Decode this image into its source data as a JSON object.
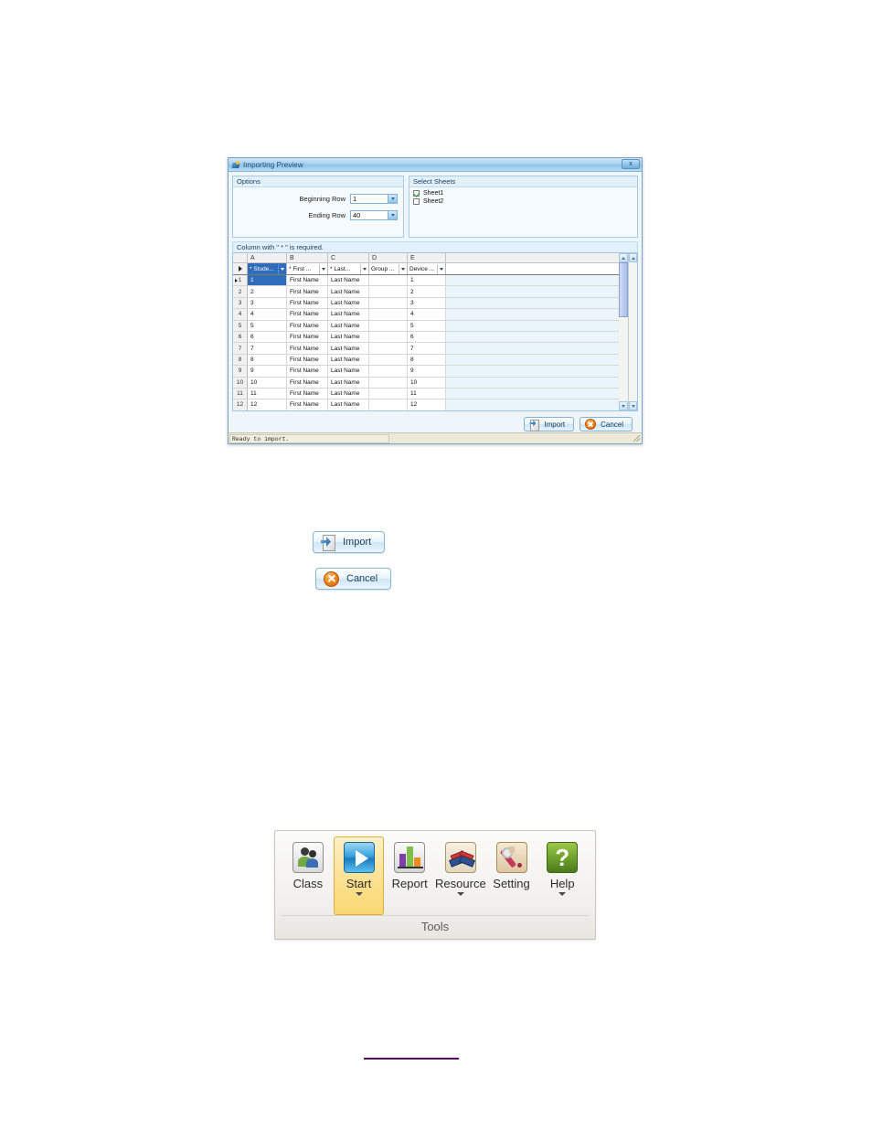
{
  "dialog": {
    "title": "Importing Preview",
    "title_icon": "import-sheet-icon",
    "close_label": "x",
    "options": {
      "group_title": "Options",
      "beginning_row_label": "Beginning Row",
      "beginning_row_value": "1",
      "ending_row_label": "Ending Row",
      "ending_row_value": "40"
    },
    "sheets": {
      "group_title": "Select Sheets",
      "items": [
        {
          "label": "Sheet1",
          "checked": true
        },
        {
          "label": "Sheet2",
          "checked": false
        }
      ]
    },
    "required_note": "Column with \" * \" is required.",
    "grid": {
      "column_letters": [
        "A",
        "B",
        "C",
        "D",
        "E"
      ],
      "field_headers": [
        "* Stude...",
        "* First ...",
        "* Last...",
        "Group ...",
        "Device ..."
      ],
      "rows": [
        {
          "n": "1",
          "cells": [
            "1",
            "First Name",
            "Last Name",
            "",
            "1"
          ]
        },
        {
          "n": "2",
          "cells": [
            "2",
            "First Name",
            "Last Name",
            "",
            "2"
          ]
        },
        {
          "n": "3",
          "cells": [
            "3",
            "First Name",
            "Last Name",
            "",
            "3"
          ]
        },
        {
          "n": "4",
          "cells": [
            "4",
            "First Name",
            "Last Name",
            "",
            "4"
          ]
        },
        {
          "n": "5",
          "cells": [
            "5",
            "First Name",
            "Last Name",
            "",
            "5"
          ]
        },
        {
          "n": "6",
          "cells": [
            "6",
            "First Name",
            "Last Name",
            "",
            "6"
          ]
        },
        {
          "n": "7",
          "cells": [
            "7",
            "First Name",
            "Last Name",
            "",
            "7"
          ]
        },
        {
          "n": "8",
          "cells": [
            "8",
            "First Name",
            "Last Name",
            "",
            "8"
          ]
        },
        {
          "n": "9",
          "cells": [
            "9",
            "First Name",
            "Last Name",
            "",
            "9"
          ]
        },
        {
          "n": "10",
          "cells": [
            "10",
            "First Name",
            "Last Name",
            "",
            "10"
          ]
        },
        {
          "n": "11",
          "cells": [
            "11",
            "First Name",
            "Last Name",
            "",
            "11"
          ]
        },
        {
          "n": "12",
          "cells": [
            "12",
            "First Name",
            "Last Name",
            "",
            "12"
          ]
        }
      ]
    },
    "buttons": {
      "import_label": "Import",
      "cancel_label": "Cancel"
    },
    "status": "Ready to import."
  },
  "standalone_buttons": {
    "import_label": "Import",
    "cancel_label": "Cancel"
  },
  "ribbon": {
    "group_label": "Tools",
    "items": [
      {
        "label": "Class",
        "icon": "people-icon",
        "active": false,
        "has_caret": false
      },
      {
        "label": "Start",
        "icon": "play-icon",
        "active": true,
        "has_caret": true
      },
      {
        "label": "Report",
        "icon": "bar-chart-icon",
        "active": false,
        "has_caret": false
      },
      {
        "label": "Resource",
        "icon": "books-icon",
        "active": false,
        "has_caret": true
      },
      {
        "label": "Setting",
        "icon": "wrench-icon",
        "active": false,
        "has_caret": false
      },
      {
        "label": "Help",
        "icon": "question-icon",
        "active": false,
        "has_caret": true
      }
    ]
  },
  "colors": {
    "dialog_accent": "#8ec2e8",
    "selection": "#2f6cba",
    "ribbon_active": "#f9d873",
    "cancel_icon": "#f08a1e",
    "footer_rule": "#5b0a6b"
  }
}
